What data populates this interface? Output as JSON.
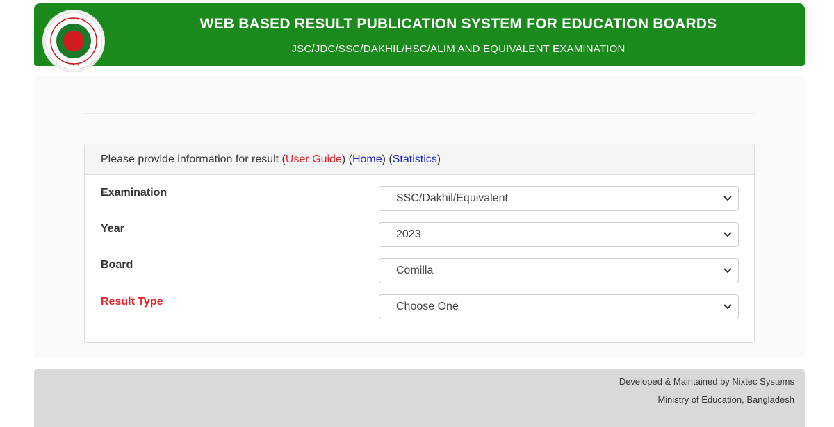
{
  "header": {
    "title": "WEB BASED RESULT PUBLICATION SYSTEM FOR EDUCATION BOARDS",
    "subtitle": "JSC/JDC/SSC/DAKHIL/HSC/ALIM AND EQUIVALENT EXAMINATION",
    "logo_icon": "bangladesh-government-seal",
    "background_color": "#1a8a1d"
  },
  "panel": {
    "intro_text": "Please provide information for result",
    "links": {
      "user_guide": "User Guide",
      "home": "Home",
      "statistics": "Statistics"
    },
    "paren_open": "(",
    "paren_close": ")",
    "link_colors": {
      "user_guide": "#e2242b",
      "home": "#1c28c8",
      "statistics": "#1c28c8"
    }
  },
  "form": {
    "examination": {
      "label": "Examination",
      "value": "SSC/Dakhil/Equivalent"
    },
    "year": {
      "label": "Year",
      "value": "2023"
    },
    "board": {
      "label": "Board",
      "value": "Comilla"
    },
    "result_type": {
      "label": "Result Type",
      "value": "Choose One",
      "label_color": "#e2242b"
    }
  },
  "footer": {
    "line1": "Developed & Maintained by Nixtec Systems",
    "line2": "Ministry of Education, Bangladesh"
  }
}
